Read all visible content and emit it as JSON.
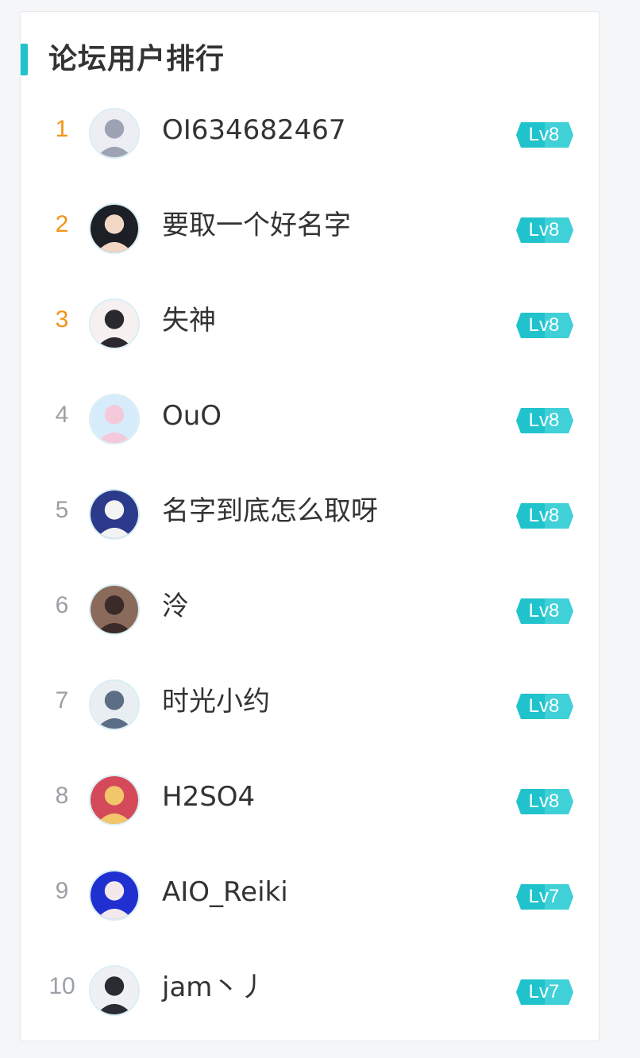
{
  "panel": {
    "title": "论坛用户排行",
    "accent_color": "#20c3cc",
    "top_rank_color": "#f29418"
  },
  "users": [
    {
      "rank": "1",
      "name": "OI634682467",
      "level": "Lv8",
      "avatar_colors": [
        "#eceef4",
        "#9ea3b3"
      ]
    },
    {
      "rank": "2",
      "name": "要取一个好名字",
      "level": "Lv8",
      "avatar_colors": [
        "#1d1f26",
        "#f2d7c4"
      ]
    },
    {
      "rank": "3",
      "name": "失神",
      "level": "Lv8",
      "avatar_colors": [
        "#f6f0f0",
        "#2a2930"
      ]
    },
    {
      "rank": "4",
      "name": "OuO",
      "level": "Lv8",
      "avatar_colors": [
        "#d7ecfb",
        "#f4c9d9"
      ]
    },
    {
      "rank": "5",
      "name": "名字到底怎么取呀",
      "level": "Lv8",
      "avatar_colors": [
        "#2b3a8a",
        "#f3f3f3"
      ]
    },
    {
      "rank": "6",
      "name": "泠",
      "level": "Lv8",
      "avatar_colors": [
        "#8a6a5a",
        "#3a2a2a"
      ]
    },
    {
      "rank": "7",
      "name": "时光小约",
      "level": "Lv8",
      "avatar_colors": [
        "#e9eef3",
        "#5c6e86"
      ]
    },
    {
      "rank": "8",
      "name": "H2SO4",
      "level": "Lv8",
      "avatar_colors": [
        "#d44a5a",
        "#f2c66a"
      ]
    },
    {
      "rank": "9",
      "name": "AIO_Reiki",
      "level": "Lv7",
      "avatar_colors": [
        "#1f2fd0",
        "#f3e9ec"
      ]
    },
    {
      "rank": "10",
      "name": "jam丶丿",
      "level": "Lv7",
      "avatar_colors": [
        "#eef0f4",
        "#2a2c33"
      ]
    }
  ]
}
